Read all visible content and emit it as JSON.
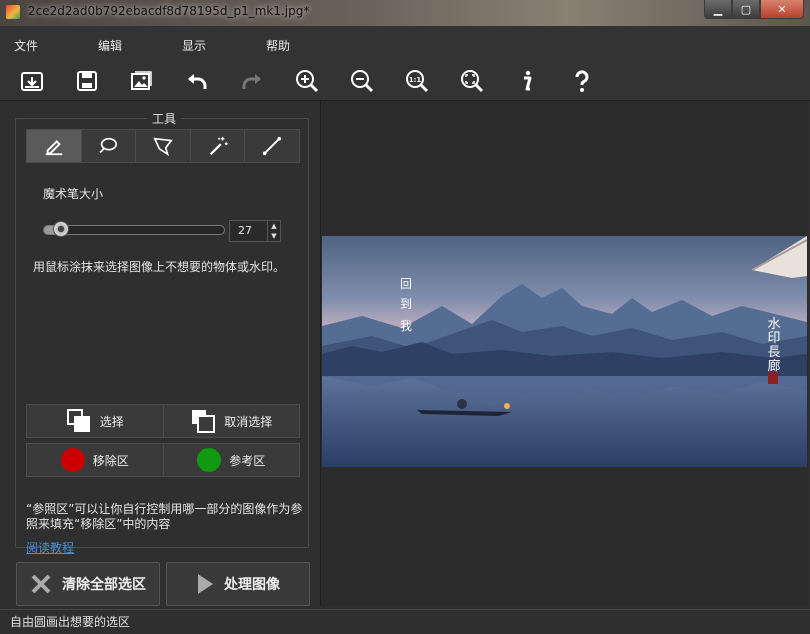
{
  "window": {
    "title": "2ce2d2ad0b792ebacdf8d78195d_p1_mk1.jpg*",
    "controls": [
      "minimize",
      "maximize",
      "close"
    ]
  },
  "menu": [
    "文件",
    "编辑",
    "显示",
    "帮助"
  ],
  "toolbar": {
    "icons": [
      "open-icon",
      "save-icon",
      "batch-images-icon",
      "undo-icon",
      "redo-icon",
      "zoom-in-icon",
      "zoom-out-icon",
      "actual-size-icon",
      "fit-window-icon",
      "info-icon",
      "help-icon"
    ],
    "redo_disabled": true,
    "actual_size_label": "1:1"
  },
  "tools_panel": {
    "title": "工具",
    "tools": [
      "marker-pen-icon",
      "lasso-icon",
      "polygon-lasso-icon",
      "magic-wand-icon",
      "line-icon"
    ],
    "active_tool": "marker-pen-icon",
    "brush_size_label": "魔术笔大小",
    "brush_size_value": "27",
    "hint": "用鼠标涂抹来选择图像上不想要的物体或水印。",
    "select_label": "选择",
    "deselect_label": "取消选择",
    "remove_area_label": "移除区",
    "reference_area_label": "参考区",
    "remove_color": "#cc0000",
    "reference_color": "#119911",
    "reference_text": "“参照区”可以让你自行控制用哪一部分的图像作为参照来填充“移除区”中的内容",
    "tutorial_link": "阅读教程"
  },
  "actions": {
    "clear_all": "清除全部选区",
    "process": "处理图像"
  },
  "image": {
    "text_left": [
      "回",
      "到",
      "我"
    ],
    "text_right": [
      "水",
      "印",
      "長",
      "廊"
    ]
  },
  "status": "自由圆画出想要的选区"
}
